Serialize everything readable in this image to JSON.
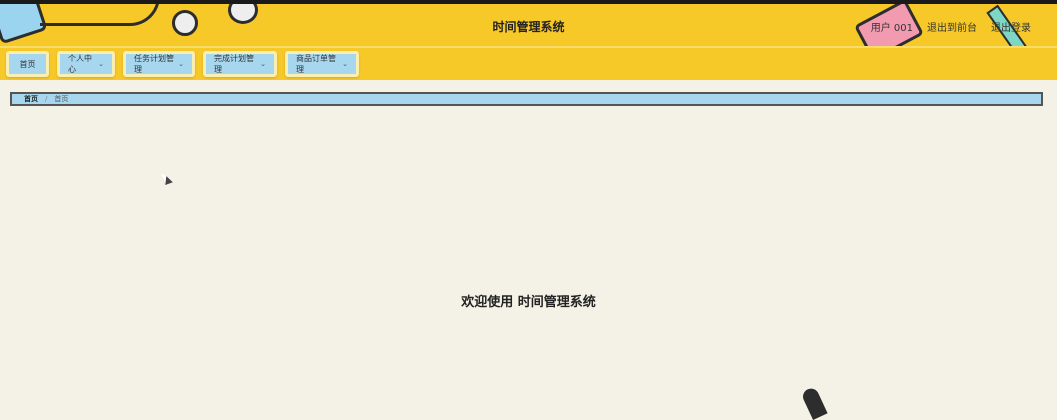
{
  "header": {
    "title": "时间管理系统",
    "user": "用户 001",
    "back_to_front": "退出到前台",
    "logout": "退出登录"
  },
  "nav": {
    "items": [
      {
        "label": "首页",
        "dropdown": false
      },
      {
        "label": "个人中心",
        "dropdown": true
      },
      {
        "label": "任务计划管理",
        "dropdown": true
      },
      {
        "label": "完成计划管理",
        "dropdown": true
      },
      {
        "label": "商品订单管理",
        "dropdown": true
      }
    ]
  },
  "breadcrumb": {
    "home": "首页",
    "current": "首页"
  },
  "main": {
    "welcome": "欢迎使用 时间管理系统"
  },
  "colors": {
    "header_bg": "#f6c928",
    "nav_button_bg": "#a6d7ef",
    "page_bg": "#f4f1e6"
  }
}
